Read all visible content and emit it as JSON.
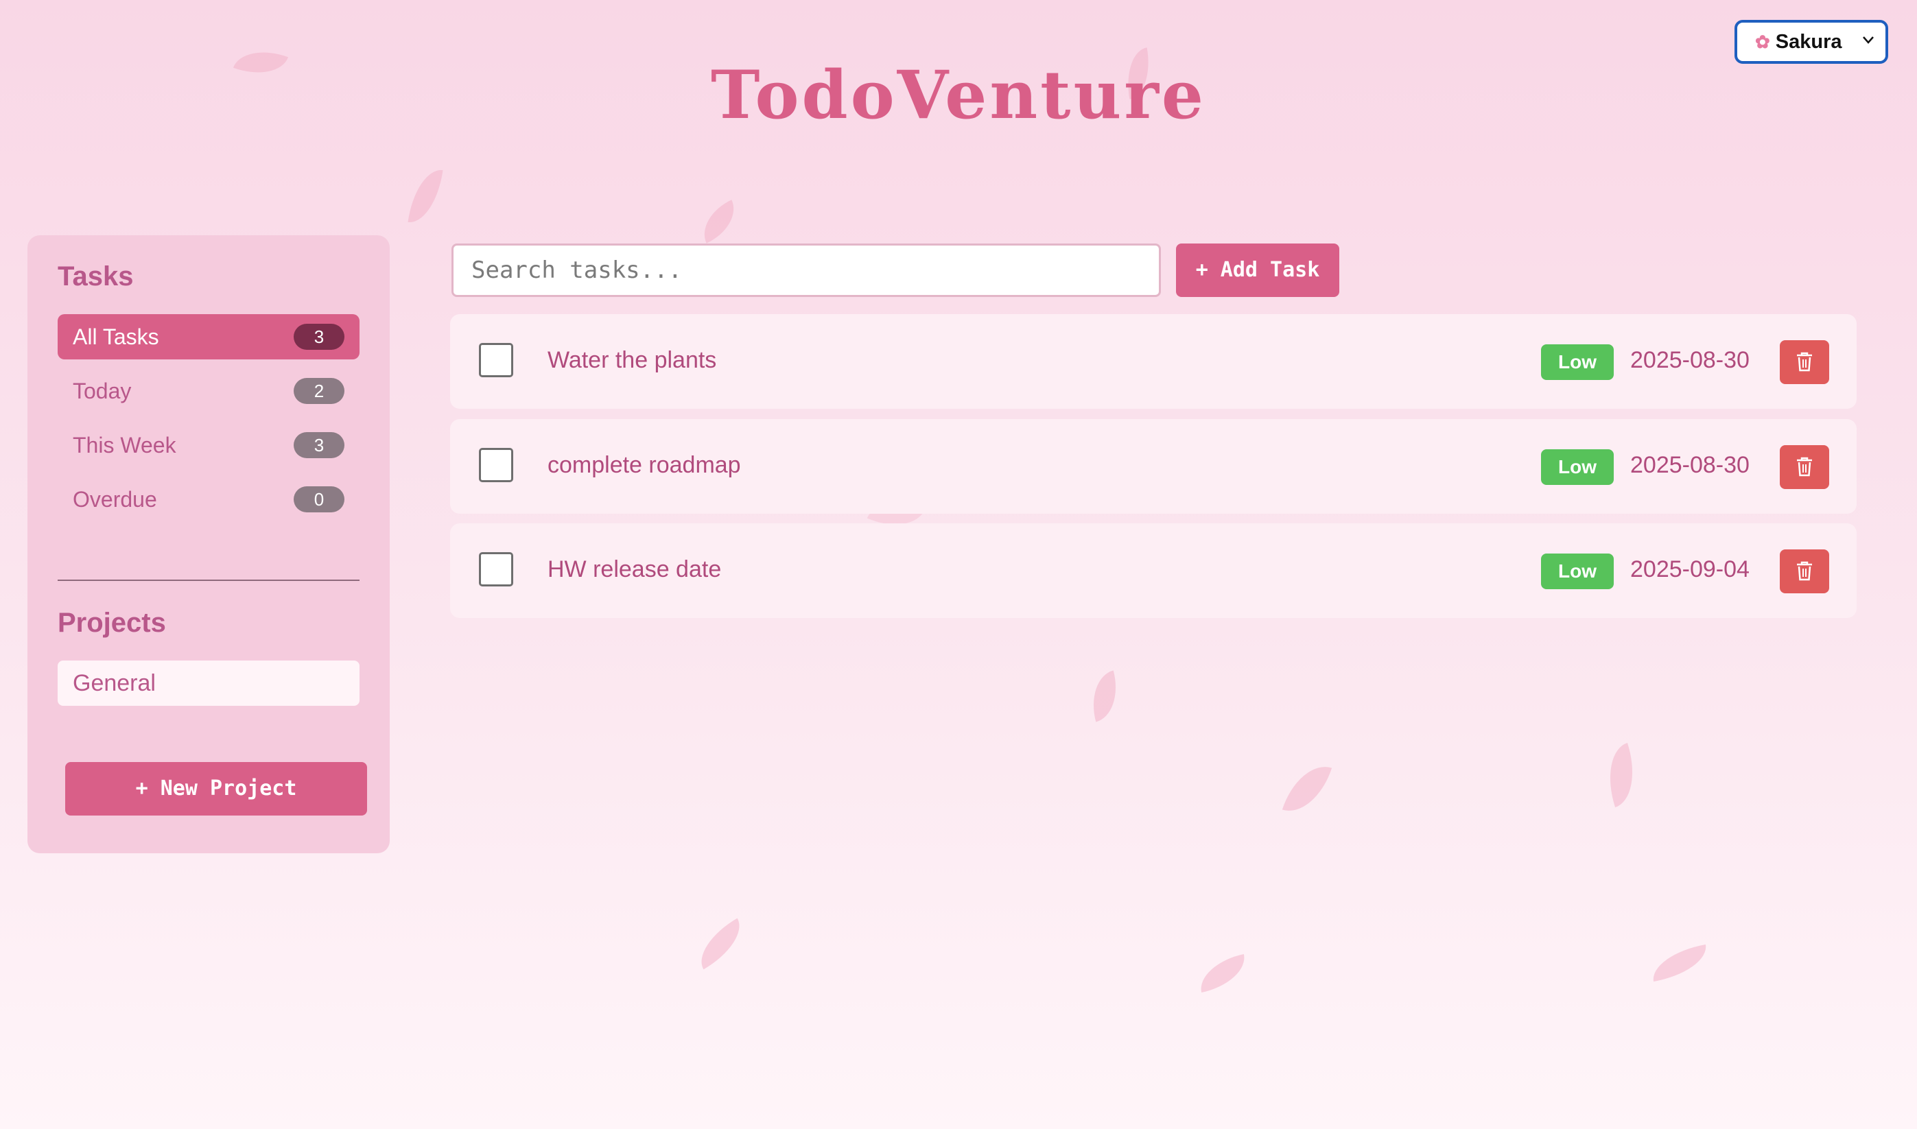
{
  "app": {
    "title": "TodoVenture"
  },
  "theme_select": {
    "icon": "cherry-blossom-icon",
    "selected": "Sakura"
  },
  "sidebar": {
    "tasks_heading": "Tasks",
    "filters": [
      {
        "label": "All Tasks",
        "count": "3",
        "active": true
      },
      {
        "label": "Today",
        "count": "2",
        "active": false
      },
      {
        "label": "This Week",
        "count": "3",
        "active": false
      },
      {
        "label": "Overdue",
        "count": "0",
        "active": false
      }
    ],
    "projects_heading": "Projects",
    "projects": [
      {
        "label": "General"
      }
    ],
    "new_project_label": "+ New Project"
  },
  "toolbar": {
    "search_placeholder": "Search tasks...",
    "add_task_label": "+ Add Task"
  },
  "tasks": [
    {
      "title": "Water the plants",
      "priority": "Low",
      "due": "2025-08-30",
      "done": false
    },
    {
      "title": "complete roadmap",
      "priority": "Low",
      "due": "2025-08-30",
      "done": false
    },
    {
      "title": "HW release date",
      "priority": "Low",
      "due": "2025-09-04",
      "done": false
    }
  ],
  "colors": {
    "accent": "#d95f88",
    "priority_low": "#57c25a",
    "delete": "#e05a5a",
    "background_top": "#f9d7e6"
  }
}
